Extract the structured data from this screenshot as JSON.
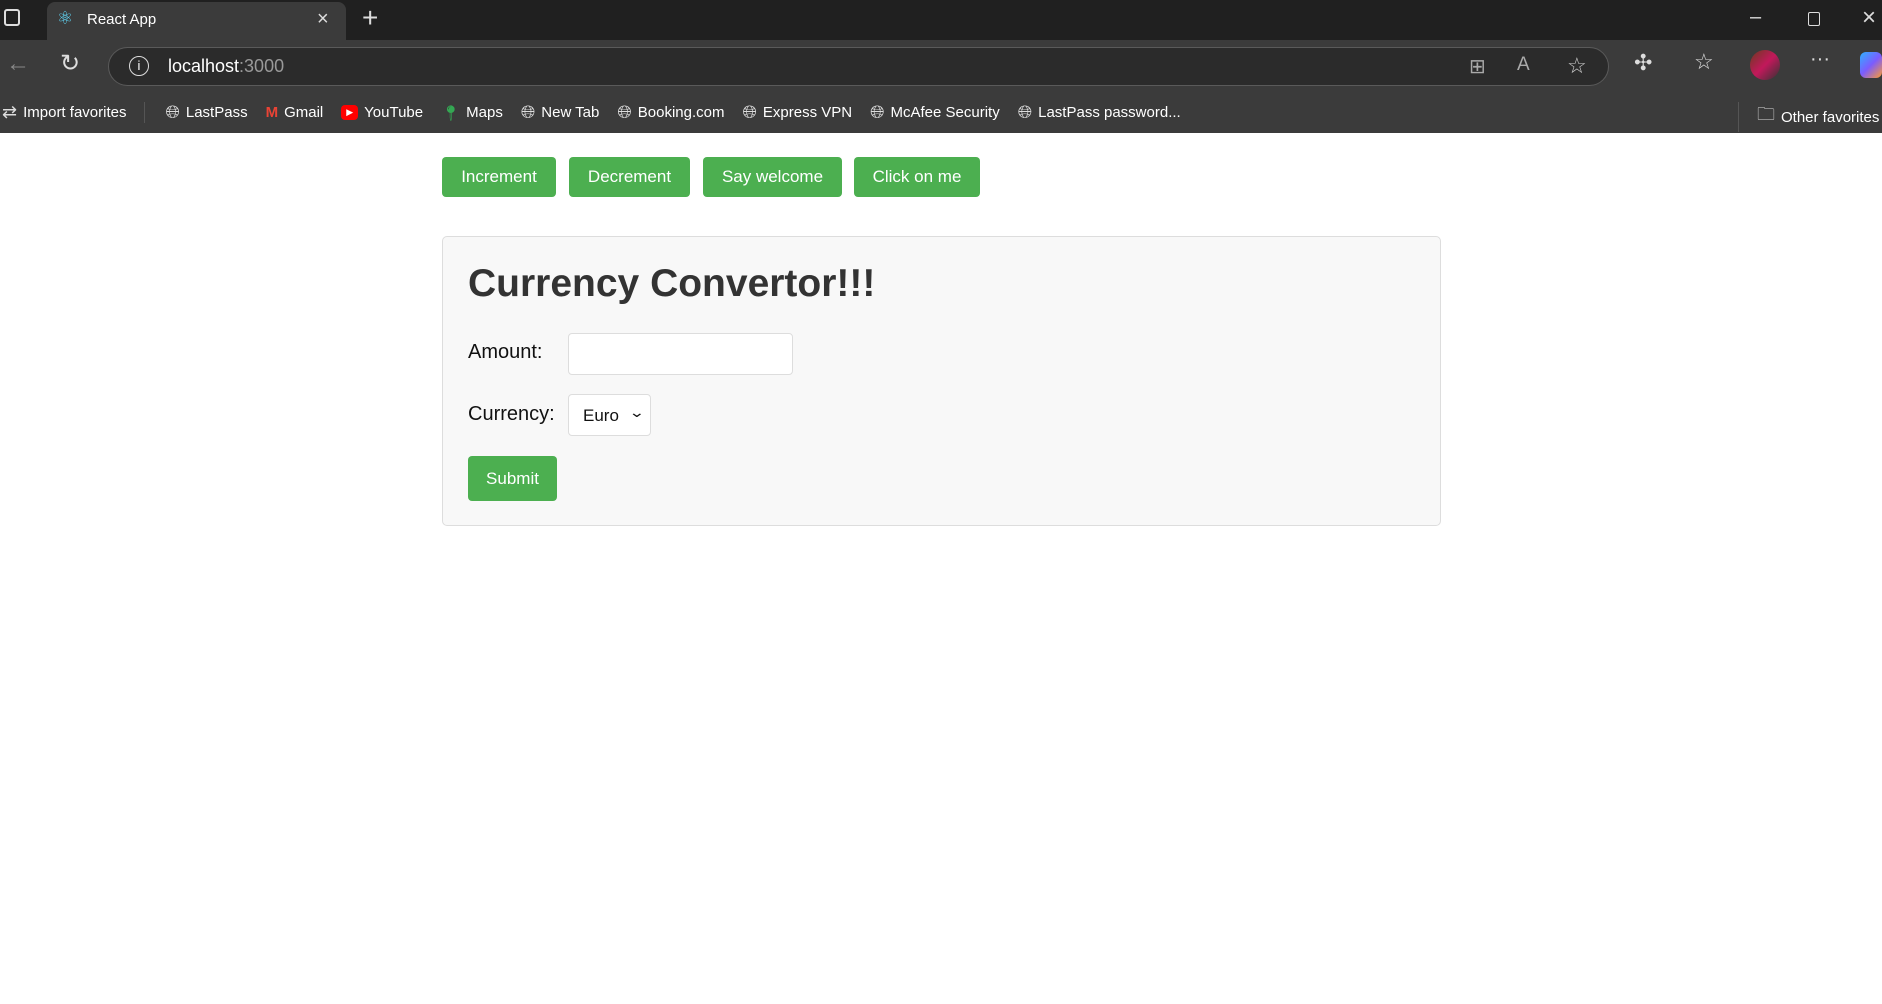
{
  "browser": {
    "tab_title": "React App",
    "url_host": "localhost",
    "url_port": ":3000",
    "bookmarks": [
      "Import favorites",
      "LastPass",
      "Gmail",
      "YouTube",
      "Maps",
      "New Tab",
      "Booking.com",
      "Express VPN",
      "McAfee Security",
      "LastPass password..."
    ],
    "other_favorites": "Other favorites"
  },
  "actions": {
    "increment": "Increment",
    "decrement": "Decrement",
    "welcome": "Say welcome",
    "click": "Click on me"
  },
  "converter": {
    "title": "Currency Convertor!!!",
    "amount_label": "Amount:",
    "amount_value": "",
    "currency_label": "Currency:",
    "currency_selected": "Euro",
    "submit": "Submit"
  },
  "colors": {
    "accent": "#4caf50"
  }
}
